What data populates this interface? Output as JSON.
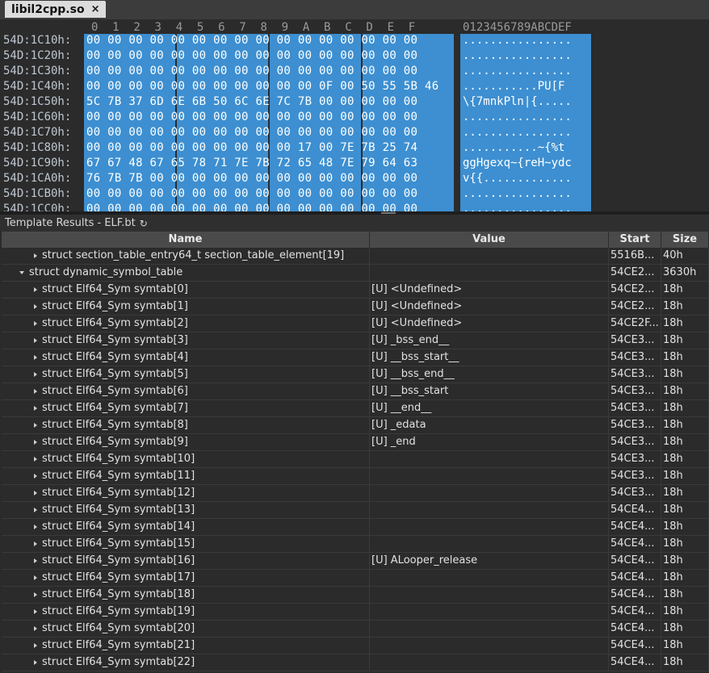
{
  "tab": {
    "title": "libil2cpp.so",
    "close_icon": "×"
  },
  "hex_view": {
    "column_header": "0  1  2  3  4  5  6  7  8  9  A  B  C  D  E  F",
    "ascii_header": "0123456789ABCDEF",
    "rows": [
      {
        "address": "54D:1C10h:",
        "bytes": "00 00 00 00 00 00 00 00 00 00 00 00 00 00 00 00",
        "ascii": "................"
      },
      {
        "address": "54D:1C20h:",
        "bytes": "00 00 00 00 00 00 00 00 00 00 00 00 00 00 00 00",
        "ascii": "................"
      },
      {
        "address": "54D:1C30h:",
        "bytes": "00 00 00 00 00 00 00 00 00 00 00 00 00 00 00 00",
        "ascii": "................"
      },
      {
        "address": "54D:1C40h:",
        "bytes": "00 00 00 00 00 00 00 00 00 00 00 0F 00 50 55 5B 46",
        "ascii": "...........PU[F"
      },
      {
        "address": "54D:1C50h:",
        "bytes": "5C 7B 37 6D 6E 6B 50 6C 6E 7C 7B 00 00 00 00 00",
        "ascii": "\\{7mnkPln|{....."
      },
      {
        "address": "54D:1C60h:",
        "bytes": "00 00 00 00 00 00 00 00 00 00 00 00 00 00 00 00",
        "ascii": "................"
      },
      {
        "address": "54D:1C70h:",
        "bytes": "00 00 00 00 00 00 00 00 00 00 00 00 00 00 00 00",
        "ascii": "................"
      },
      {
        "address": "54D:1C80h:",
        "bytes": "00 00 00 00 00 00 00 00 00 00 17 00 7E 7B 25 74",
        "ascii": "...........~{%t"
      },
      {
        "address": "54D:1C90h:",
        "bytes": "67 67 48 67 65 78 71 7E 7B 72 65 48 7E 79 64 63",
        "ascii": "ggHgexq~{reH~ydc"
      },
      {
        "address": "54D:1CA0h:",
        "bytes": "76 7B 7B 00 00 00 00 00 00 00 00 00 00 00 00 00",
        "ascii": "v{{............."
      },
      {
        "address": "54D:1CB0h:",
        "bytes": "00 00 00 00 00 00 00 00 00 00 00 00 00 00 00 00",
        "ascii": "................"
      },
      {
        "address": "54D:1CC0h:",
        "bytes": "00 00 00 00 00 00 00 00 00 00 00 00 00 00 00 00",
        "ascii": "................"
      }
    ]
  },
  "template_results": {
    "title": "Template Results - ELF.bt",
    "refresh_icon": "↻"
  },
  "table": {
    "headers": {
      "name": "Name",
      "value": "Value",
      "start": "Start",
      "size": "Size"
    },
    "rows": [
      {
        "name": "struct section_table_entry64_t section_table_element[19]",
        "value": "",
        "start": "5516B...",
        "size": "40h",
        "indent": 1,
        "expanded": false
      },
      {
        "name": "struct dynamic_symbol_table",
        "value": "",
        "start": "54CE2...",
        "size": "3630h",
        "indent": 0,
        "expanded": true
      },
      {
        "name": "struct Elf64_Sym symtab[0]",
        "value": "[U] <Undefined>",
        "start": "54CE2...",
        "size": "18h",
        "indent": 1,
        "expanded": false
      },
      {
        "name": "struct Elf64_Sym symtab[1]",
        "value": "[U] <Undefined>",
        "start": "54CE2...",
        "size": "18h",
        "indent": 1,
        "expanded": false
      },
      {
        "name": "struct Elf64_Sym symtab[2]",
        "value": "[U] <Undefined>",
        "start": "54CE2F...",
        "size": "18h",
        "indent": 1,
        "expanded": false
      },
      {
        "name": "struct Elf64_Sym symtab[3]",
        "value": "[U] _bss_end__",
        "start": "54CE3...",
        "size": "18h",
        "indent": 1,
        "expanded": false
      },
      {
        "name": "struct Elf64_Sym symtab[4]",
        "value": "[U] __bss_start__",
        "start": "54CE3...",
        "size": "18h",
        "indent": 1,
        "expanded": false
      },
      {
        "name": "struct Elf64_Sym symtab[5]",
        "value": "[U] __bss_end__",
        "start": "54CE3...",
        "size": "18h",
        "indent": 1,
        "expanded": false
      },
      {
        "name": "struct Elf64_Sym symtab[6]",
        "value": "[U] __bss_start",
        "start": "54CE3...",
        "size": "18h",
        "indent": 1,
        "expanded": false
      },
      {
        "name": "struct Elf64_Sym symtab[7]",
        "value": "[U] __end__",
        "start": "54CE3...",
        "size": "18h",
        "indent": 1,
        "expanded": false
      },
      {
        "name": "struct Elf64_Sym symtab[8]",
        "value": "[U] _edata",
        "start": "54CE3...",
        "size": "18h",
        "indent": 1,
        "expanded": false
      },
      {
        "name": "struct Elf64_Sym symtab[9]",
        "value": "[U] _end",
        "start": "54CE3...",
        "size": "18h",
        "indent": 1,
        "expanded": false
      },
      {
        "name": "struct Elf64_Sym symtab[10]",
        "value": "",
        "start": "54CE3...",
        "size": "18h",
        "indent": 1,
        "expanded": false
      },
      {
        "name": "struct Elf64_Sym symtab[11]",
        "value": "",
        "start": "54CE3...",
        "size": "18h",
        "indent": 1,
        "expanded": false
      },
      {
        "name": "struct Elf64_Sym symtab[12]",
        "value": "",
        "start": "54CE3...",
        "size": "18h",
        "indent": 1,
        "expanded": false
      },
      {
        "name": "struct Elf64_Sym symtab[13]",
        "value": "",
        "start": "54CE4...",
        "size": "18h",
        "indent": 1,
        "expanded": false
      },
      {
        "name": "struct Elf64_Sym symtab[14]",
        "value": "",
        "start": "54CE4...",
        "size": "18h",
        "indent": 1,
        "expanded": false
      },
      {
        "name": "struct Elf64_Sym symtab[15]",
        "value": "",
        "start": "54CE4...",
        "size": "18h",
        "indent": 1,
        "expanded": false
      },
      {
        "name": "struct Elf64_Sym symtab[16]",
        "value": "[U] ALooper_release",
        "start": "54CE4...",
        "size": "18h",
        "indent": 1,
        "expanded": false
      },
      {
        "name": "struct Elf64_Sym symtab[17]",
        "value": "",
        "start": "54CE4...",
        "size": "18h",
        "indent": 1,
        "expanded": false
      },
      {
        "name": "struct Elf64_Sym symtab[18]",
        "value": "",
        "start": "54CE4...",
        "size": "18h",
        "indent": 1,
        "expanded": false
      },
      {
        "name": "struct Elf64_Sym symtab[19]",
        "value": "",
        "start": "54CE4...",
        "size": "18h",
        "indent": 1,
        "expanded": false
      },
      {
        "name": "struct Elf64_Sym symtab[20]",
        "value": "",
        "start": "54CE4...",
        "size": "18h",
        "indent": 1,
        "expanded": false
      },
      {
        "name": "struct Elf64_Sym symtab[21]",
        "value": "",
        "start": "54CE4...",
        "size": "18h",
        "indent": 1,
        "expanded": false
      },
      {
        "name": "struct Elf64_Sym symtab[22]",
        "value": "",
        "start": "54CE4...",
        "size": "18h",
        "indent": 1,
        "expanded": false
      }
    ]
  },
  "colors": {
    "selection": "#3d8fd1",
    "background": "#2b2b2b",
    "header_bg": "#4a4a4a",
    "tab_bg": "#dcdcdc"
  }
}
